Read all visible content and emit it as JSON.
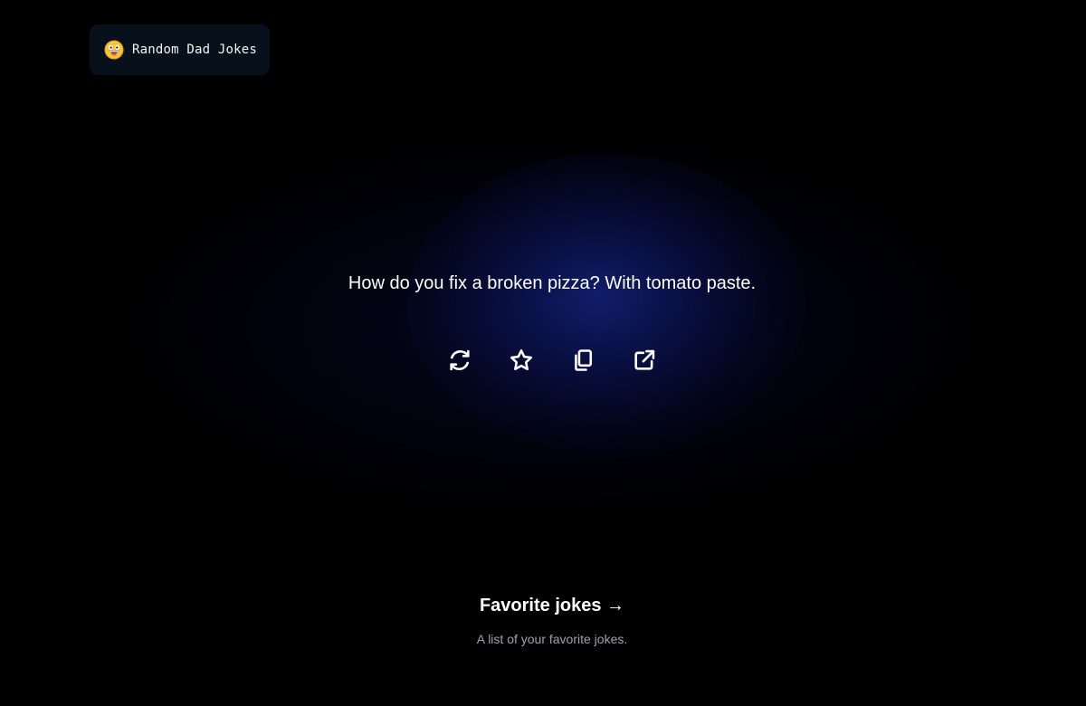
{
  "header": {
    "app_title": "Random Dad Jokes",
    "logo_icon": "grinning-face-emoji-icon"
  },
  "joke": {
    "text": "How do you fix a broken pizza? With tomato paste."
  },
  "actions": [
    {
      "name": "refresh",
      "icon": "refresh-icon"
    },
    {
      "name": "favorite",
      "icon": "star-icon"
    },
    {
      "name": "copy",
      "icon": "copy-icon"
    },
    {
      "name": "share",
      "icon": "external-link-icon"
    }
  ],
  "favorites": {
    "link_label": "Favorite jokes →",
    "description": "A list of your favorite jokes."
  },
  "colors": {
    "background": "#000000",
    "glow": "#121e6e",
    "badge_background": "#07111c",
    "text": "#ffffff",
    "muted_text": "#9ea3ab"
  }
}
